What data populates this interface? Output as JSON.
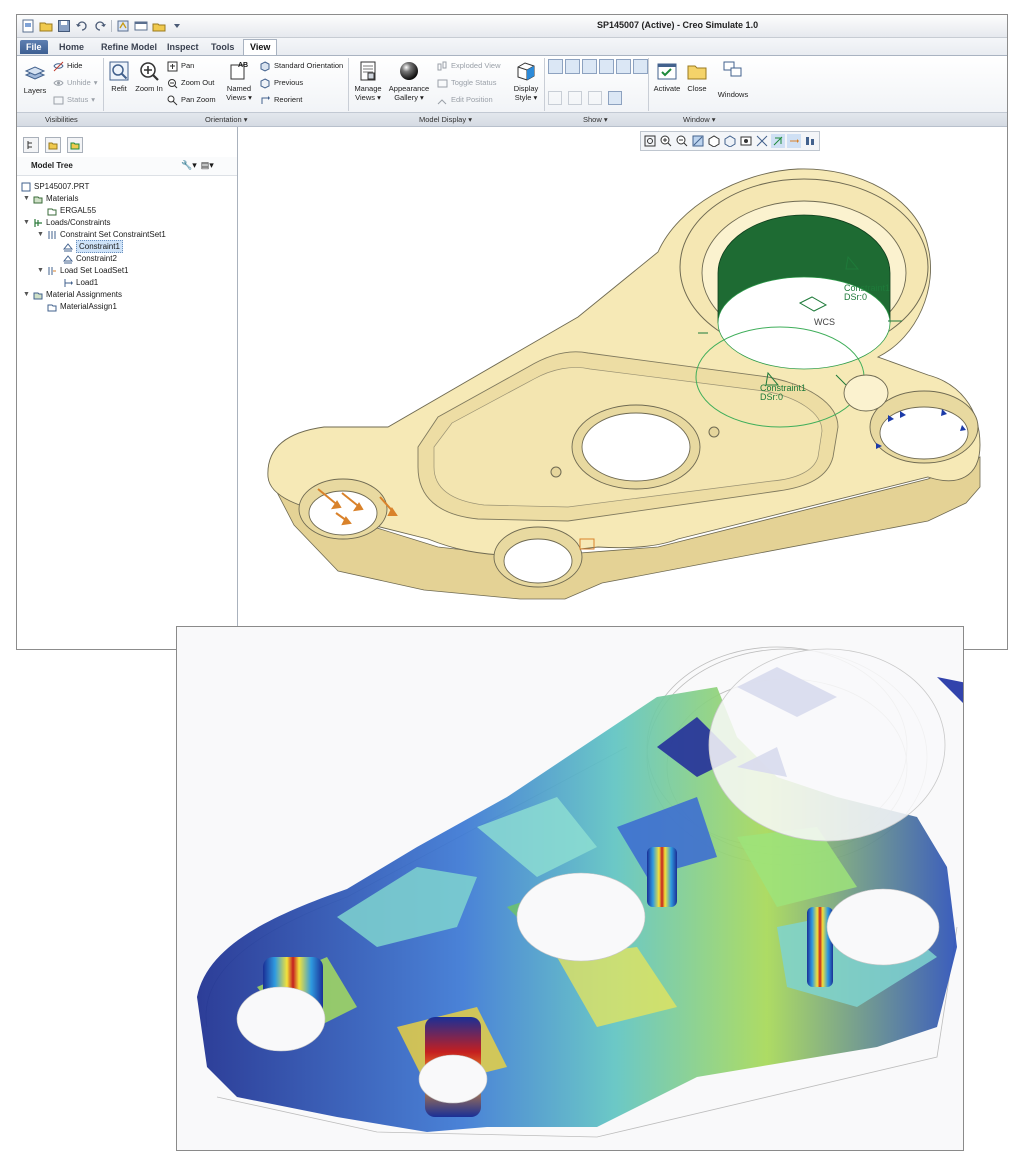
{
  "window": {
    "title": "SP145007 (Active) - Creo Simulate 1.0"
  },
  "tabs": [
    {
      "label": "File",
      "kind": "file"
    },
    {
      "label": "Home"
    },
    {
      "label": "Refine Model"
    },
    {
      "label": "Inspect"
    },
    {
      "label": "Tools"
    },
    {
      "label": "View",
      "kind": "active"
    }
  ],
  "ribbon": {
    "visibility": {
      "layers": "Layers",
      "hide": "Hide",
      "unhide": "Unhide",
      "status": "Status"
    },
    "orientation": {
      "refit": "Refit",
      "zoom_in": "Zoom In",
      "pan": "Pan",
      "zoom_out": "Zoom Out",
      "pan_zoom": "Pan Zoom",
      "named_views": "Named",
      "named_views_2": "Views",
      "standard_orientation": "Standard Orientation",
      "previous": "Previous",
      "reorient": "Reorient"
    },
    "model_display": {
      "manage_views": "Manage",
      "manage_views_2": "Views",
      "appearance_gallery": "Appearance",
      "appearance_gallery_2": "Gallery",
      "exploded_view": "Exploded View",
      "toggle_status": "Toggle Status",
      "edit_position": "Edit Position",
      "display_style": "Display",
      "display_style_2": "Style"
    },
    "window": {
      "activate": "Activate",
      "close": "Close",
      "windows": "Windows"
    },
    "group_labels": [
      "Visibilities",
      "Orientation",
      "Model Display",
      "Show",
      "Window"
    ]
  },
  "model_tree": {
    "title": "Model Tree",
    "items": [
      {
        "label": "SP145007.PRT"
      },
      {
        "label": "Materials"
      },
      {
        "label": "ERGAL55"
      },
      {
        "label": "Loads/Constraints"
      },
      {
        "label": "Constraint Set ConstraintSet1"
      },
      {
        "label": "Constraint1"
      },
      {
        "label": "Constraint2"
      },
      {
        "label": "Load Set LoadSet1"
      },
      {
        "label": "Load1"
      },
      {
        "label": "Material Assignments"
      },
      {
        "label": "MaterialAssign1"
      }
    ]
  },
  "viewport": {
    "labels": {
      "constraint_a": "Constraint1",
      "constraint_a_dsr": "DSr:0",
      "constraint_b": "Constraint1",
      "constraint_b_dsr": "DSr:0",
      "wcs": "WCS"
    }
  },
  "colors": {
    "part_fill": "#f6e9b6",
    "part_edge": "#6f6a52",
    "constraint_green": "#1e6b33",
    "load_arrow": "#d9822b",
    "accent_blue": "#3d5f92"
  }
}
